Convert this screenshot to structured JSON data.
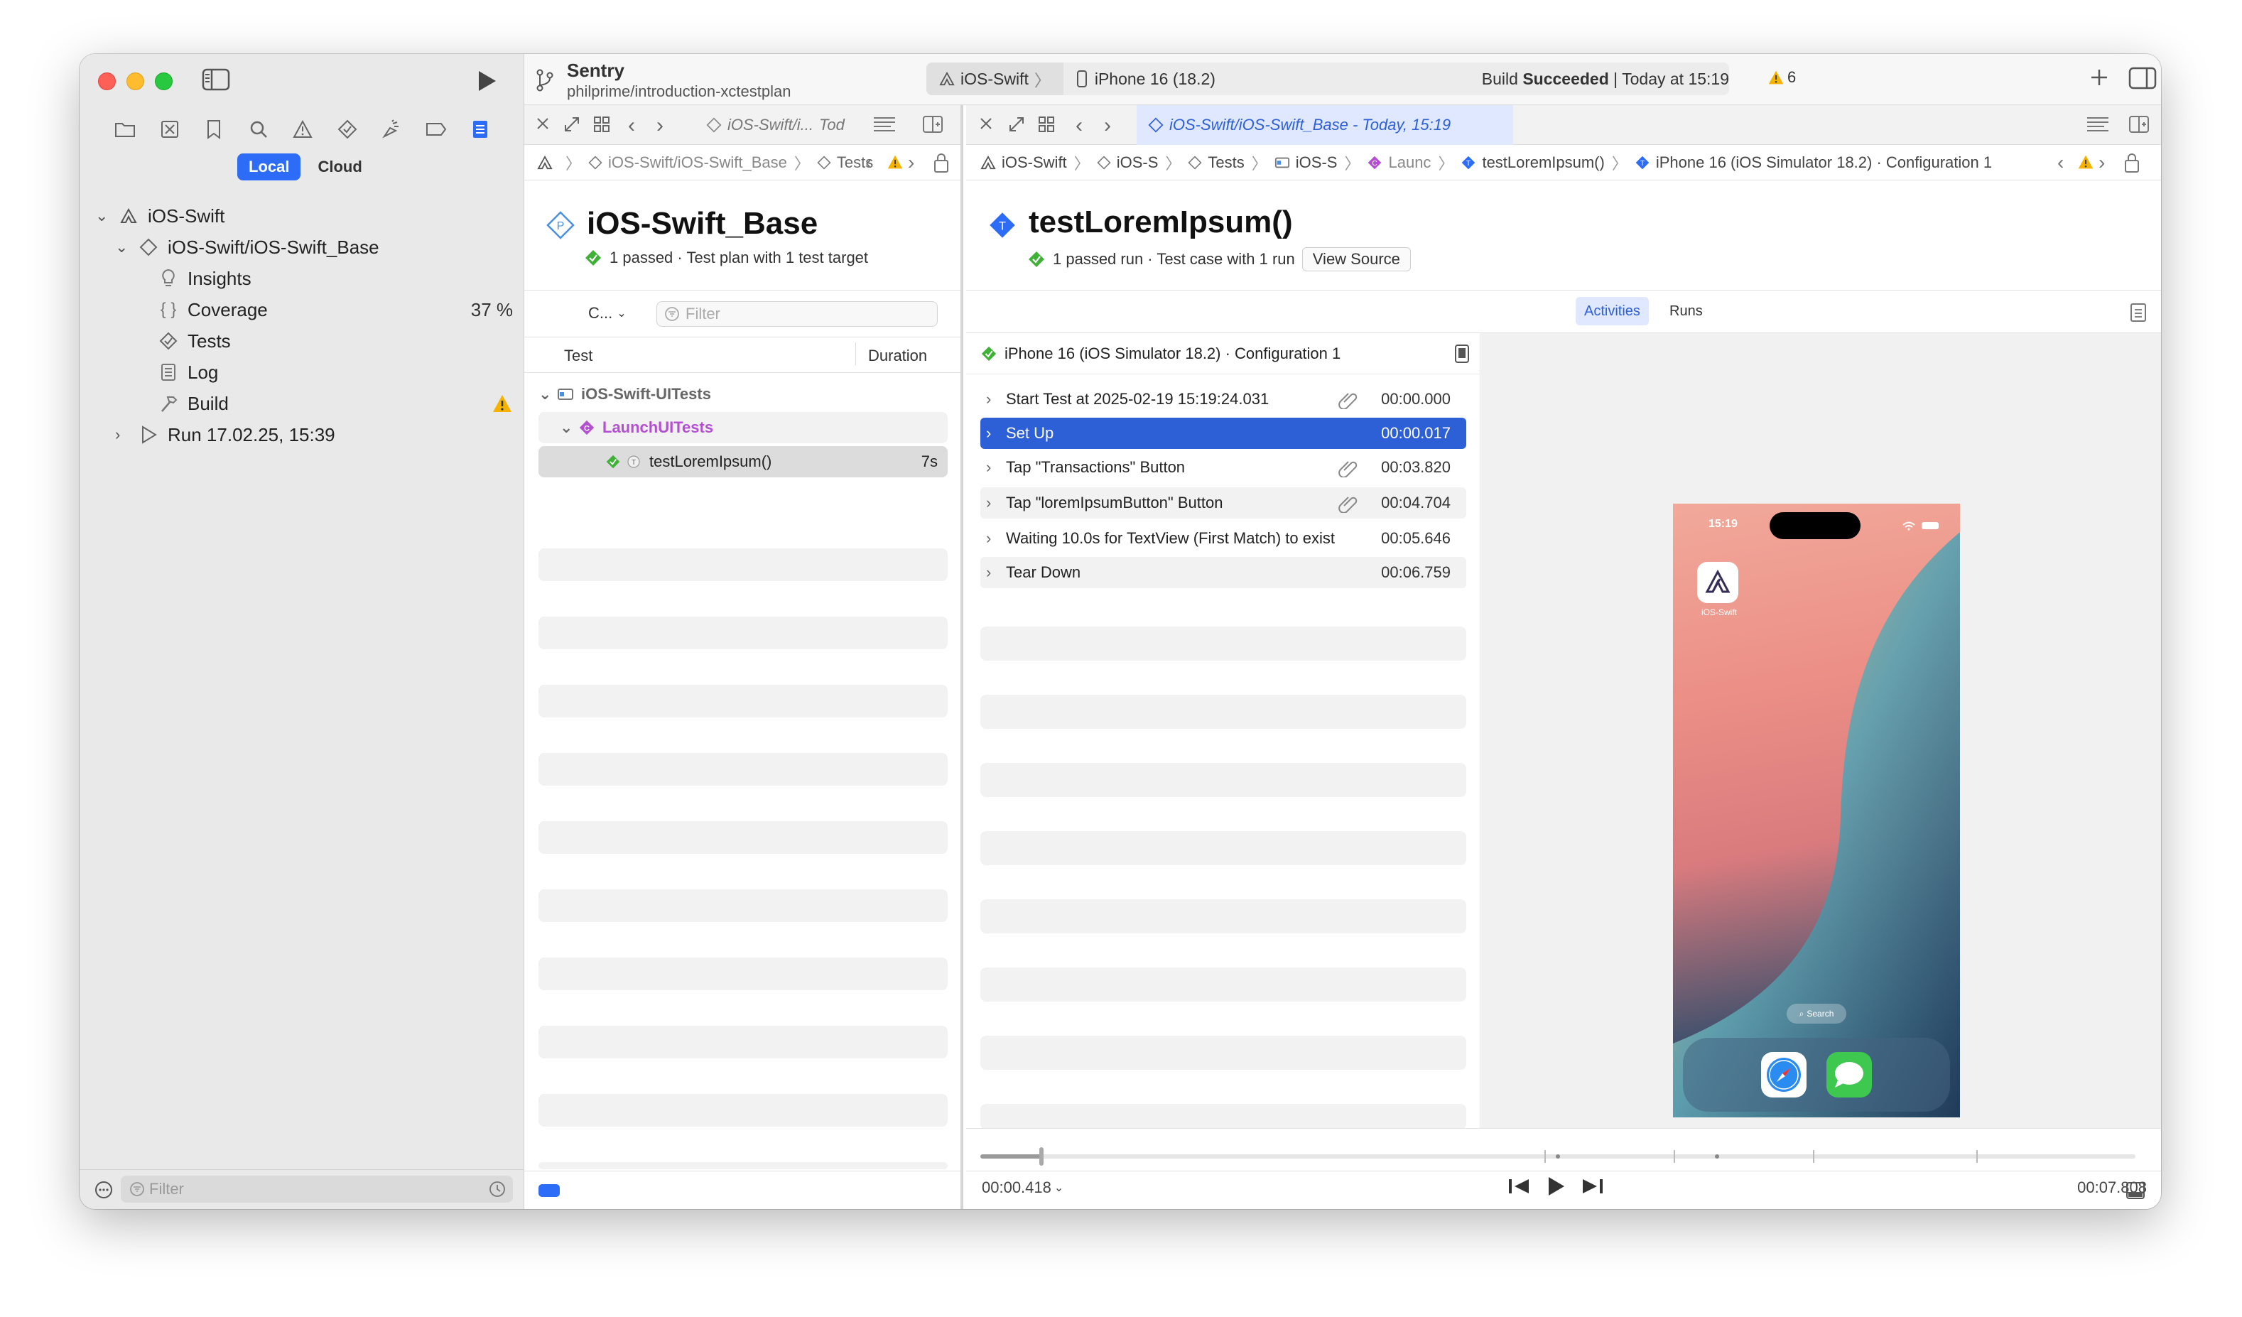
{
  "sidebar": {
    "seg_local": "Local",
    "seg_cloud": "Cloud",
    "tree": {
      "root": "iOS-Swift",
      "plan": "iOS-Swift/iOS-Swift_Base",
      "insights": "Insights",
      "coverage": "Coverage",
      "coverage_value": "37 %",
      "tests": "Tests",
      "log": "Log",
      "build": "Build",
      "run": "Run 17.02.25, 15:39"
    },
    "filter_placeholder": "Filter"
  },
  "toolbar": {
    "scheme": "Sentry",
    "branch": "philprime/introduction-xctestplan",
    "target": "iOS-Swift",
    "device": "iPhone 16 (18.2)",
    "status_prefix": "Build",
    "status_bold": "Succeeded",
    "status_time": "| Today at 15:19",
    "warning_count": "6"
  },
  "middle": {
    "tab_label": "iOS-Swift/i...",
    "tab_suffix": "Tod",
    "jump": [
      "iOS-Swift/iOS-Swift_Base",
      "iOS-Swift/iOS-Swift",
      "Tests"
    ],
    "title": "iOS-Swift_Base",
    "subtitle": "1 passed · Test plan with 1 test target",
    "filter_menu": "C...",
    "filter_placeholder": "Filter",
    "col_test": "Test",
    "col_duration": "Duration",
    "tree": {
      "target": "iOS-Swift-UITests",
      "class": "LaunchUITests",
      "method": "testLoremIpsum()",
      "method_duration": "7s"
    }
  },
  "right": {
    "tab_label": "iOS-Swift/iOS-Swift_Base - Today, 15:19",
    "jump": {
      "a": "iOS-Swift",
      "b": "iOS-S",
      "c": "Tests",
      "d": "iOS-S",
      "e": "Launc",
      "f": "testLoremIpsum()",
      "g": "iPhone 16 (iOS Simulator 18.2) · Configuration 1"
    },
    "title": "testLoremIpsum()",
    "subtitle": "1 passed run · Test case with 1 run",
    "view_source": "View Source",
    "tab_activities": "Activities",
    "tab_runs": "Runs",
    "config_header": "iPhone 16 (iOS Simulator 18.2) · Configuration 1",
    "activities": [
      {
        "label": "Start Test at 2025-02-19 15:19:24.031",
        "time": "00:00.000"
      },
      {
        "label": "Set Up",
        "time": "00:00.017"
      },
      {
        "label": "Tap \"Transactions\" Button",
        "time": "00:03.820"
      },
      {
        "label": "Tap \"loremIpsumButton\" Button",
        "time": "00:04.704"
      },
      {
        "label": "Waiting 10.0s for TextView (First Match) to exist",
        "time": "00:05.646"
      },
      {
        "label": "Tear Down",
        "time": "00:06.759"
      }
    ],
    "phone": {
      "clock": "15:19",
      "app_label": "iOS-Swift",
      "search": "Search"
    },
    "timeline": {
      "current": "00:00.418",
      "total": "00:07.808",
      "progress": 0.053
    }
  },
  "colors": {
    "accent": "#2d6cf6",
    "selection": "#2d5fd6",
    "pass": "#3fb136",
    "warning": "#f5b300",
    "test_purple": "#b34fd1"
  }
}
